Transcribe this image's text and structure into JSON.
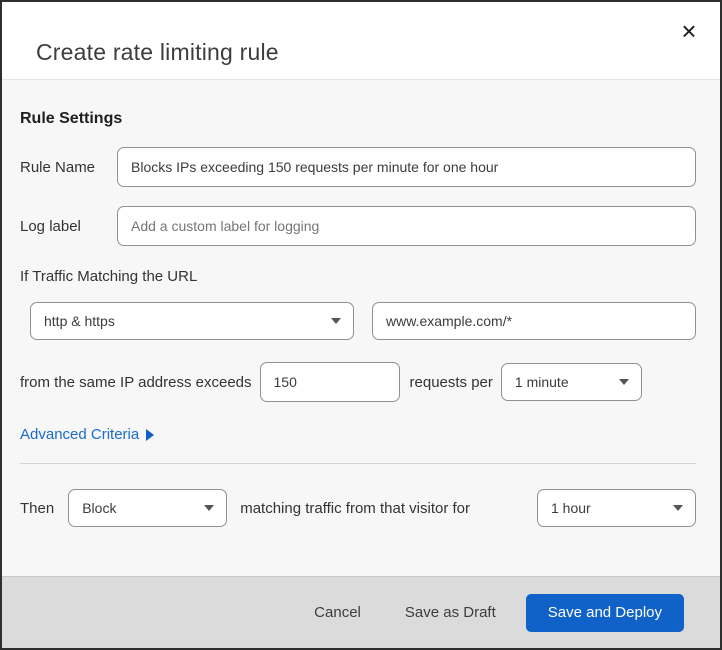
{
  "dialog": {
    "title": "Create rate limiting rule",
    "close_glyph": "×"
  },
  "rule_settings": {
    "heading": "Rule Settings",
    "rule_name": {
      "label": "Rule Name",
      "value": "Blocks IPs exceeding 150 requests per minute for one hour"
    },
    "log_label": {
      "label": "Log label",
      "placeholder": "Add a custom label for logging"
    }
  },
  "traffic_match": {
    "heading": "If Traffic Matching the URL",
    "protocol_select": {
      "value": "http & https"
    },
    "url_input": {
      "value": "www.example.com/*"
    },
    "threshold": {
      "prefix_text": "from the same IP address exceeds",
      "requests_value": "150",
      "middle_text": "requests per",
      "period_select": {
        "value": "1 minute"
      }
    },
    "advanced_criteria": {
      "label": "Advanced Criteria"
    }
  },
  "action": {
    "prefix_text": "Then",
    "action_select": {
      "value": "Block"
    },
    "middle_text": "matching traffic from that visitor for",
    "duration_select": {
      "value": "1 hour"
    }
  },
  "footer": {
    "cancel_label": "Cancel",
    "save_draft_label": "Save as Draft",
    "save_deploy_label": "Save and Deploy"
  },
  "colors": {
    "primary_button_blue": "#1062c8",
    "link_blue": "#1a6bcc",
    "footer_background": "#dbdbdb",
    "body_background": "#f7f7f7"
  }
}
